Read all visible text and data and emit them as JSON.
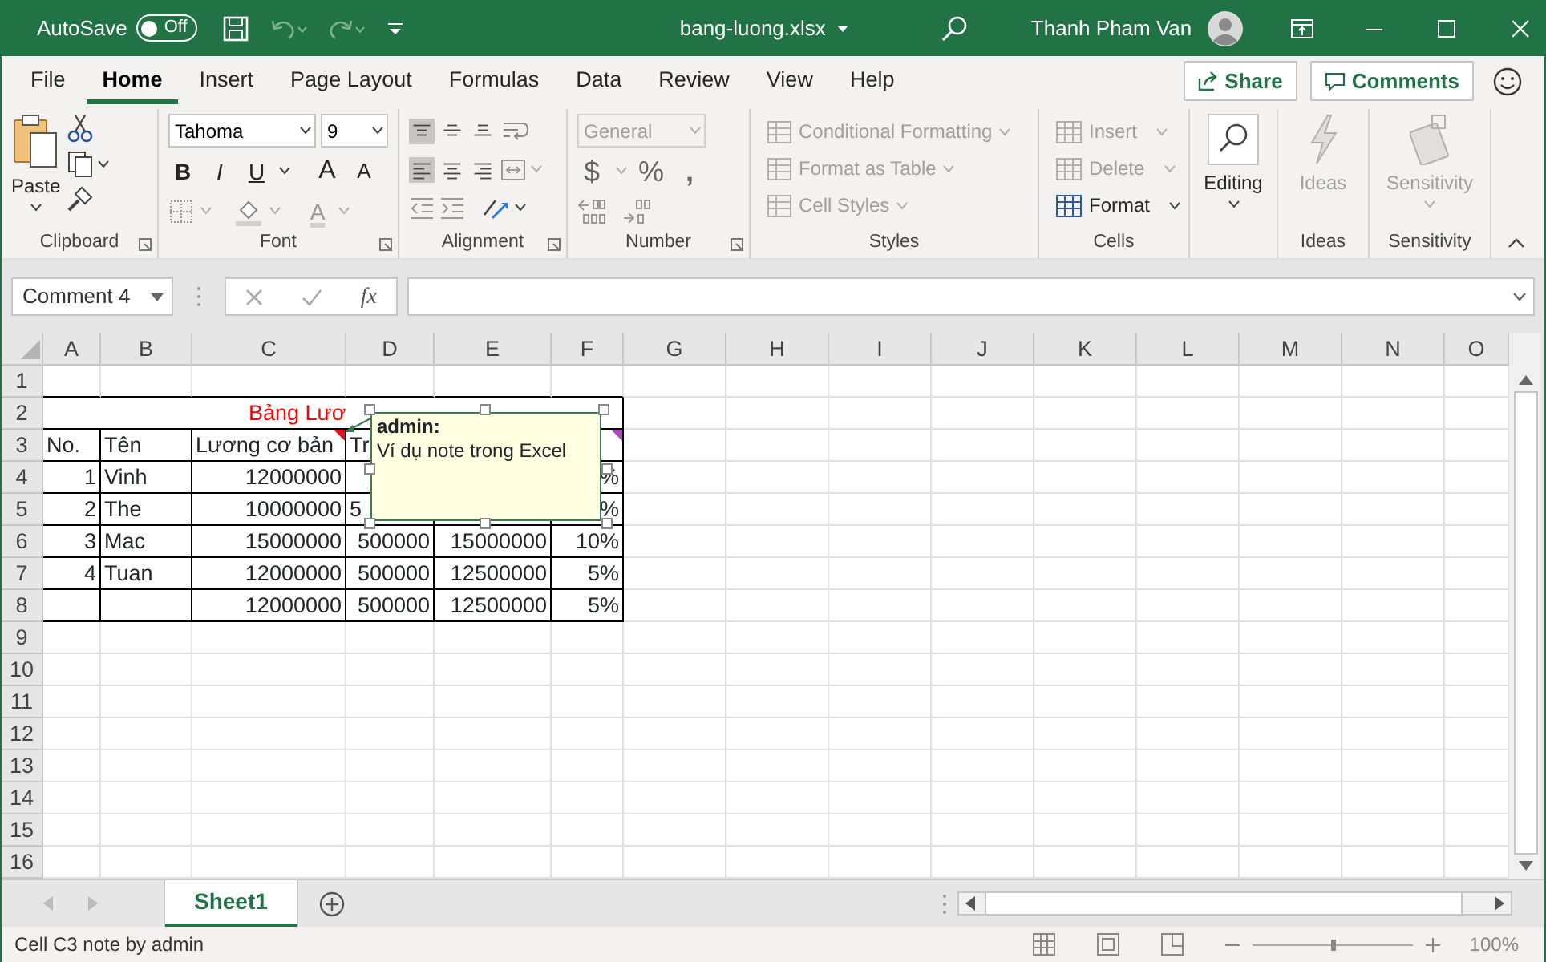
{
  "title_bar": {
    "autosave_label": "AutoSave",
    "autosave": {
      "on": false,
      "label": "Off"
    },
    "file_name": "bang-luong.xlsx",
    "user_name": "Thanh Pham Van"
  },
  "menu_tabs": [
    {
      "label": "File",
      "selected": false
    },
    {
      "label": "Home",
      "selected": true
    },
    {
      "label": "Insert",
      "selected": false
    },
    {
      "label": "Page Layout",
      "selected": false
    },
    {
      "label": "Formulas",
      "selected": false
    },
    {
      "label": "Data",
      "selected": false
    },
    {
      "label": "Review",
      "selected": false
    },
    {
      "label": "View",
      "selected": false
    },
    {
      "label": "Help",
      "selected": false
    }
  ],
  "share_button": "Share",
  "comments_button": "Comments",
  "ribbon": {
    "groups": [
      {
        "kind": "clipboard",
        "label": "Clipboard",
        "paste_label": "Paste"
      },
      {
        "kind": "font",
        "label": "Font",
        "font_name": "Tahoma",
        "font_size": "9",
        "style_buttons": [
          "B",
          "I",
          "U"
        ],
        "grow_label": "A",
        "shrink_label": "A",
        "color_label": "A"
      },
      {
        "kind": "alignment",
        "label": "Alignment",
        "vertical": [
          {
            "selected": true
          },
          {
            "selected": false
          },
          {
            "selected": false
          }
        ],
        "horizontal": [
          {
            "selected": true
          },
          {
            "selected": false
          },
          {
            "selected": false
          }
        ]
      },
      {
        "kind": "number",
        "label": "Number",
        "format": {
          "value": "General",
          "disabled": true
        },
        "symbols": [
          "$",
          "%",
          ","
        ]
      },
      {
        "kind": "styles",
        "label": "Styles",
        "items": [
          {
            "label": "Conditional Formatting",
            "disabled": true
          },
          {
            "label": "Format as Table",
            "disabled": true
          },
          {
            "label": "Cell Styles",
            "disabled": true
          }
        ]
      },
      {
        "kind": "cells",
        "label": "Cells",
        "items": [
          {
            "label": "Insert",
            "disabled": true
          },
          {
            "label": "Delete",
            "disabled": true
          },
          {
            "label": "Format",
            "disabled": false
          }
        ]
      },
      {
        "kind": "editing",
        "button": {
          "label": "Editing",
          "disabled": false
        }
      },
      {
        "kind": "ideas",
        "label": "Ideas",
        "button": {
          "label": "Ideas",
          "disabled": true
        }
      },
      {
        "kind": "sensitivity",
        "label": "Sensitivity",
        "button": {
          "label": "Sensitivity",
          "disabled": true
        }
      }
    ]
  },
  "formula_bar": {
    "name_box": "Comment 4",
    "function_label": "fx"
  },
  "grid": {
    "columns": [
      "A",
      "B",
      "C",
      "D",
      "E",
      "F",
      "G",
      "H",
      "I",
      "J",
      "K",
      "L",
      "M",
      "N",
      "O"
    ],
    "rows": [
      {
        "header": "1",
        "kind": "empty"
      },
      {
        "header": "2",
        "kind": "title",
        "cells": [
          "Bảng Lươ"
        ]
      },
      {
        "header": "3",
        "kind": "header",
        "cells": [
          "No.",
          "Tên",
          {
            "text": "Lương cơ bản",
            "note": true
          },
          "Tr",
          null,
          {
            "text": null,
            "comment": true
          }
        ]
      },
      {
        "header": "4",
        "kind": "data",
        "cells": [
          "1",
          "Vinh",
          "12000000",
          null,
          null,
          "%"
        ]
      },
      {
        "header": "5",
        "kind": "data",
        "cells": [
          "2",
          "The",
          "10000000",
          {
            "text": "5",
            "kind": "clipped"
          },
          null,
          "%"
        ]
      },
      {
        "header": "6",
        "kind": "data",
        "cells": [
          "3",
          "Mac",
          "15000000",
          "500000",
          "15000000",
          "10%"
        ]
      },
      {
        "header": "7",
        "kind": "data",
        "cells": [
          "4",
          "Tuan",
          "12000000",
          "500000",
          "12500000",
          "5%"
        ]
      },
      {
        "header": "8",
        "kind": "data",
        "cells": [
          null,
          null,
          "12000000",
          "500000",
          "12500000",
          "5%"
        ]
      },
      {
        "header": "9",
        "kind": "empty"
      },
      {
        "header": "10",
        "kind": "empty"
      },
      {
        "header": "11",
        "kind": "empty"
      },
      {
        "header": "12",
        "kind": "empty"
      },
      {
        "header": "13",
        "kind": "empty"
      },
      {
        "header": "14",
        "kind": "empty"
      },
      {
        "header": "15",
        "kind": "empty"
      },
      {
        "header": "16",
        "kind": "empty"
      }
    ],
    "note": {
      "author": "admin:",
      "text": "Ví dụ note trong Excel"
    }
  },
  "sheets": [
    {
      "label": "Sheet1",
      "selected": true
    }
  ],
  "status_bar": {
    "text": "Cell C3 note by admin",
    "zoom_slider": {
      "level": 0.5
    },
    "zoom": "100%"
  }
}
